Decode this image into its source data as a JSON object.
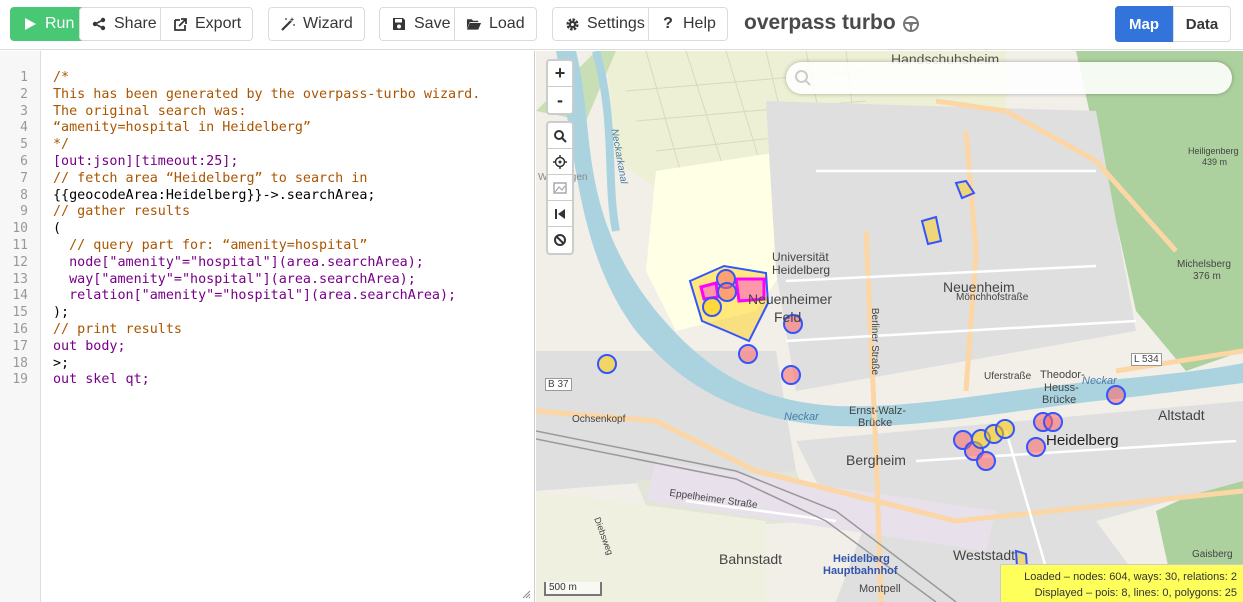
{
  "toolbar": {
    "run": "Run",
    "share": "Share",
    "export": "Export",
    "wizard": "Wizard",
    "save": "Save",
    "load": "Load",
    "settings": "Settings",
    "help": "Help"
  },
  "app": {
    "title": "overpass turbo"
  },
  "view_toggle": {
    "map": "Map",
    "data": "Data"
  },
  "editor": {
    "line_numbers": [
      "1",
      "2",
      "3",
      "4",
      "5",
      "6",
      "7",
      "8",
      "9",
      "10",
      "11",
      "12",
      "13",
      "14",
      "15",
      "16",
      "17",
      "18",
      "19"
    ],
    "lines": [
      "/*",
      "This has been generated by the overpass-turbo wizard.",
      "The original search was:",
      "“amenity=hospital in Heidelberg”",
      "*/",
      "[out:json][timeout:25];",
      "// fetch area “Heidelberg” to search in",
      "{{geocodeArea:Heidelberg}}->.searchArea;",
      "// gather results",
      "(",
      "  // query part for: “amenity=hospital”",
      "  node[\"amenity\"=\"hospital\"](area.searchArea);",
      "  way[\"amenity\"=\"hospital\"](area.searchArea);",
      "  relation[\"amenity\"=\"hospital\"](area.searchArea);",
      ");",
      "// print results",
      "out body;",
      ">;",
      "out skel qt;"
    ]
  },
  "map": {
    "zoom_in": "+",
    "zoom_out": "-",
    "scale": "500 m",
    "labels": {
      "handschuhsheim": "Handschuhsheim",
      "neuenheim": "Neuenheim",
      "monchhof": "Mönchhofstraße",
      "univ": "Universität",
      "univ2": "Heidelberg",
      "neuenheimer": "Neuenheimer",
      "feld": "Feld",
      "berliner": "Berliner Straße",
      "uferstr": "Uferstraße",
      "theodor": "Theodor-",
      "heuss": "Heuss-",
      "brucke": "Brücke",
      "ernst": "Ernst-Walz-",
      "ernst2": "Brücke",
      "neckar": "Neckar",
      "neckar2": "Neckar",
      "neckarkanal": "Neckarkanal",
      "altstadt": "Altstadt",
      "heidelberg": "Heidelberg",
      "bergheim": "Bergheim",
      "ochsenkopf": "Ochsenkopf",
      "eppelheimer": "Eppelheimer Straße",
      "bahnstadt": "Bahnstadt",
      "hbf": "Heidelberg",
      "hbf2": "Hauptbahnhof",
      "weststadt": "Weststadt",
      "montpell": "Montpell",
      "heiligenberg": "Heiligenberg",
      "heiligenberg_h": "439 m",
      "michelsberg": "Michelsberg",
      "michelsberg_h": "376 m",
      "gaisberg": "Gaisberg",
      "b37": "B 37",
      "l534": "L 534",
      "dossenheim": "Diebsweg",
      "wieblingen": "Wieblingen"
    },
    "stats": {
      "loaded": "Loaded – nodes: 604, ways: 30, relations: 2",
      "displayed": "Displayed – pois: 8, lines: 0, polygons: 25"
    }
  }
}
